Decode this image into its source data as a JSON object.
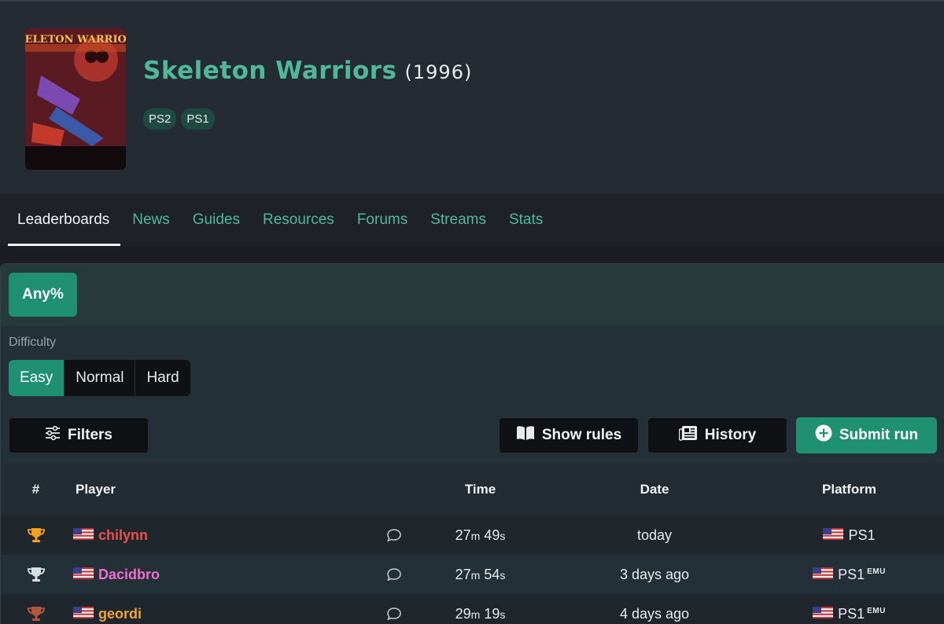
{
  "game": {
    "title": "Skeleton Warriors",
    "year": "(1996)",
    "cover_text": "SKELETON WARRIORS",
    "platforms": [
      "PS2",
      "PS1"
    ]
  },
  "tabs": [
    {
      "label": "Leaderboards",
      "active": true
    },
    {
      "label": "News"
    },
    {
      "label": "Guides"
    },
    {
      "label": "Resources"
    },
    {
      "label": "Forums"
    },
    {
      "label": "Streams"
    },
    {
      "label": "Stats"
    }
  ],
  "category": {
    "label": "Any%"
  },
  "difficulty": {
    "label": "Difficulty",
    "options": [
      "Easy",
      "Normal",
      "Hard"
    ],
    "selected": "Easy"
  },
  "actions": {
    "filters": "Filters",
    "show_rules": "Show rules",
    "history": "History",
    "submit_run": "Submit run"
  },
  "table": {
    "headers": {
      "rank": "#",
      "player": "Player",
      "time": "Time",
      "date": "Date",
      "platform": "Platform"
    },
    "rows": [
      {
        "rank_icon": "gold-trophy",
        "flag": "us",
        "player": "chilynn",
        "player_color": "#e8524a",
        "time_m": "27",
        "time_s": "49",
        "date": "today",
        "platform": "PS1",
        "emu": ""
      },
      {
        "rank_icon": "silver-trophy",
        "flag": "us",
        "player": "Dacidbro",
        "player_color": "#ee6fd0",
        "time_m": "27",
        "time_s": "54",
        "date": "3 days ago",
        "platform": "PS1",
        "emu": "EMU"
      },
      {
        "rank_icon": "bronze-trophy",
        "flag": "us",
        "player": "geordi",
        "player_color": "#f0a13a",
        "time_m": "29",
        "time_s": "19",
        "date": "4 days ago",
        "platform": "PS1",
        "emu": "EMU"
      }
    ],
    "units": {
      "m": "m",
      "s": "s"
    }
  },
  "colors": {
    "accent": "#1f9170",
    "link": "#4fb99a",
    "gold": "#f2a21a",
    "silver": "#d8dde2",
    "bronze": "#b5563a"
  }
}
